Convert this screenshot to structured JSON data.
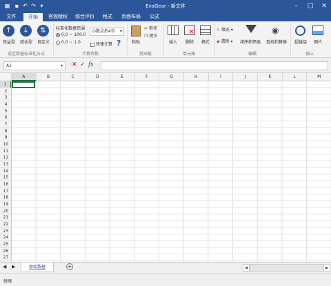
{
  "window": {
    "title": "EvaGear - 新文件"
  },
  "tabs": [
    "文件",
    "开始",
    "客观赋权",
    "综合评价",
    "格式",
    "页面布局",
    "公式"
  ],
  "ribbon": {
    "standardize": {
      "btn_benefit": "效益型",
      "btn_cost": "成本型",
      "btn_custom": "自定义",
      "group_label": "设定数据标准化方式"
    },
    "calc": {
      "range_label": "标准化数据范围",
      "radio1": "0.0 ~ 100.0",
      "radio2": "0.0 ~ 1.0",
      "precision": "小数点后4位",
      "quick_calc": "快速计算",
      "help": "?",
      "group_label": "计算参数"
    },
    "clipboard": {
      "paste": "粘贴",
      "cut": "剪切",
      "copy": "拷贝",
      "group_label": "剪贴板"
    },
    "cells": {
      "insert": "插入",
      "delete": "删除",
      "format": "格式",
      "group_label": "单元格"
    },
    "edit": {
      "fill": "填充",
      "clear": "清除",
      "sort_filter": "排序和筛选",
      "find_replace": "查找和替换",
      "group_label": "编辑"
    },
    "insert": {
      "hyperlink": "超链接",
      "picture": "图片",
      "group_label": "插入"
    }
  },
  "formula_bar": {
    "name_box": "A1",
    "fx": "fx"
  },
  "grid": {
    "columns": [
      "A",
      "B",
      "C",
      "D",
      "E",
      "F",
      "G",
      "H",
      "I",
      "J",
      "K",
      "L",
      "M"
    ],
    "rows": [
      "1",
      "2",
      "3",
      "4",
      "5",
      "6",
      "7",
      "8",
      "9",
      "10",
      "11",
      "12",
      "13",
      "14",
      "15",
      "16",
      "17",
      "18",
      "19",
      "20",
      "21",
      "22",
      "23",
      "24",
      "25",
      "26",
      "27"
    ]
  },
  "sheets": {
    "active": "原始数据"
  },
  "status": {
    "text": "就绪"
  },
  "colors": {
    "accent": "#2b579a",
    "selection": "#217346"
  }
}
